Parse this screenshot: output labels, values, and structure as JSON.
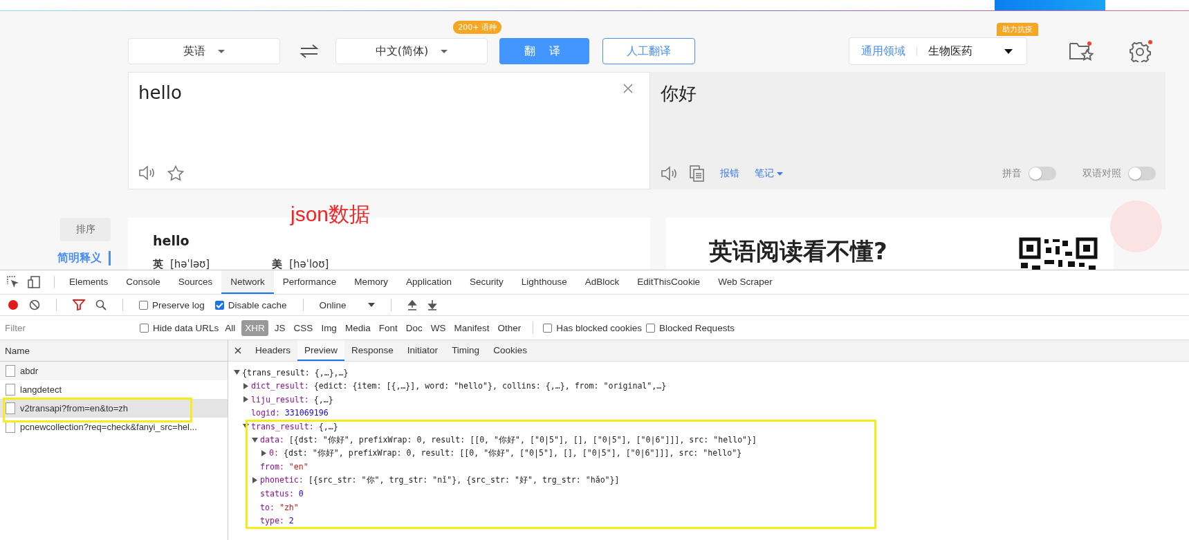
{
  "header": {
    "source_language": "英语",
    "target_language": "中文(简体)",
    "language_badge": "200+ 语种",
    "translate_button": "翻译",
    "human_translate_button": "人工翻译",
    "domain": {
      "general": "通用领域",
      "selected": "生物医药",
      "badge": "助力抗疫"
    }
  },
  "source": {
    "text": "hello"
  },
  "result": {
    "text": "你好",
    "links": [
      {
        "label": "报错",
        "kind": "plain"
      },
      {
        "label": "笔记",
        "kind": "dropdown"
      }
    ],
    "toggles": [
      {
        "label": "拼音",
        "on": false
      },
      {
        "label": "双语对照",
        "on": false
      }
    ]
  },
  "sidebar": {
    "sort_button": "排序",
    "items": [
      {
        "label": "简明释义",
        "selected": true
      }
    ]
  },
  "dictionary": {
    "word": "hello",
    "pronunciations": [
      {
        "region": "英",
        "ipa": "[həˈləʊ]"
      },
      {
        "region": "美",
        "ipa": "[həˈloʊ]"
      }
    ]
  },
  "ad": {
    "headline": "英语阅读看不懂?"
  },
  "annotation": {
    "label": "json数据"
  },
  "devtools": {
    "tabs": [
      {
        "label": "Elements",
        "selected": false
      },
      {
        "label": "Console",
        "selected": false
      },
      {
        "label": "Sources",
        "selected": false
      },
      {
        "label": "Network",
        "selected": true
      },
      {
        "label": "Performance",
        "selected": false
      },
      {
        "label": "Memory",
        "selected": false
      },
      {
        "label": "Application",
        "selected": false
      },
      {
        "label": "Security",
        "selected": false
      },
      {
        "label": "Lighthouse",
        "selected": false
      },
      {
        "label": "AdBlock",
        "selected": false
      },
      {
        "label": "EditThisCookie",
        "selected": false
      },
      {
        "label": "Web Scraper",
        "selected": false
      }
    ],
    "toolbar": {
      "options": [
        {
          "label": "Preserve log",
          "checked": false
        },
        {
          "label": "Disable cache",
          "checked": true
        }
      ],
      "throttling": "Online"
    },
    "filter": {
      "placeholder": "Filter",
      "hide_data_urls": {
        "label": "Hide data URLs",
        "checked": false
      },
      "types": [
        {
          "label": "All",
          "selected": false
        },
        {
          "label": "XHR",
          "selected": true
        },
        {
          "label": "JS",
          "selected": false
        },
        {
          "label": "CSS",
          "selected": false
        },
        {
          "label": "Img",
          "selected": false
        },
        {
          "label": "Media",
          "selected": false
        },
        {
          "label": "Font",
          "selected": false
        },
        {
          "label": "Doc",
          "selected": false
        },
        {
          "label": "WS",
          "selected": false
        },
        {
          "label": "Manifest",
          "selected": false
        },
        {
          "label": "Other",
          "selected": false
        }
      ],
      "options": [
        {
          "label": "Has blocked cookies",
          "checked": false
        },
        {
          "label": "Blocked Requests",
          "checked": false
        }
      ]
    },
    "requests": {
      "column": "Name",
      "rows": [
        {
          "name": "abdr",
          "selected": false
        },
        {
          "name": "langdetect",
          "selected": false
        },
        {
          "name": "v2transapi?from=en&to=zh",
          "selected": true
        },
        {
          "name": "pcnewcollection?req=check&fanyi_src=hel...",
          "selected": false
        }
      ]
    },
    "detail_tabs": [
      {
        "label": "Headers",
        "selected": false
      },
      {
        "label": "Preview",
        "selected": true
      },
      {
        "label": "Response",
        "selected": false
      },
      {
        "label": "Initiator",
        "selected": false
      },
      {
        "label": "Timing",
        "selected": false
      },
      {
        "label": "Cookies",
        "selected": false
      }
    ],
    "preview": [
      {
        "kind": "object",
        "expanded": true,
        "value": "{trans_result: {,…},…}",
        "children": [
          {
            "kind": "object",
            "expanded": false,
            "key": "dict_result:",
            "value": "{edict: {item: [{,…}], word: \"hello\"}, collins: {,…}, from: \"original\",…}"
          },
          {
            "kind": "object",
            "expanded": false,
            "key": "liju_result:",
            "value": "{,…}"
          },
          {
            "kind": "number",
            "key": "logid:",
            "value": "331069196"
          },
          {
            "kind": "object",
            "expanded": true,
            "key": "trans_result:",
            "value": "{,…}",
            "children": [
              {
                "kind": "object",
                "expanded": true,
                "key": "data:",
                "value": "[{dst: \"你好\", prefixWrap: 0, result: [[0, \"你好\", [\"0|5\"], [], [\"0|5\"], [\"0|6\"]]], src: \"hello\"}]",
                "children": [
                  {
                    "kind": "object",
                    "expanded": false,
                    "key": "0:",
                    "value": "{dst: \"你好\", prefixWrap: 0, result: [[0, \"你好\", [\"0|5\"], [], [\"0|5\"], [\"0|6\"]]], src: \"hello\"}"
                  }
                ]
              },
              {
                "kind": "string",
                "key": "from:",
                "value": "\"en\""
              },
              {
                "kind": "object",
                "expanded": false,
                "key": "phonetic:",
                "value": "[{src_str: \"你\", trg_str: \"nǐ\"}, {src_str: \"好\", trg_str: \"hǎo\"}]"
              },
              {
                "kind": "number",
                "key": "status:",
                "value": "0"
              },
              {
                "kind": "string",
                "key": "to:",
                "value": "\"zh\""
              },
              {
                "kind": "number",
                "key": "type:",
                "value": "2"
              }
            ]
          }
        ]
      }
    ]
  }
}
